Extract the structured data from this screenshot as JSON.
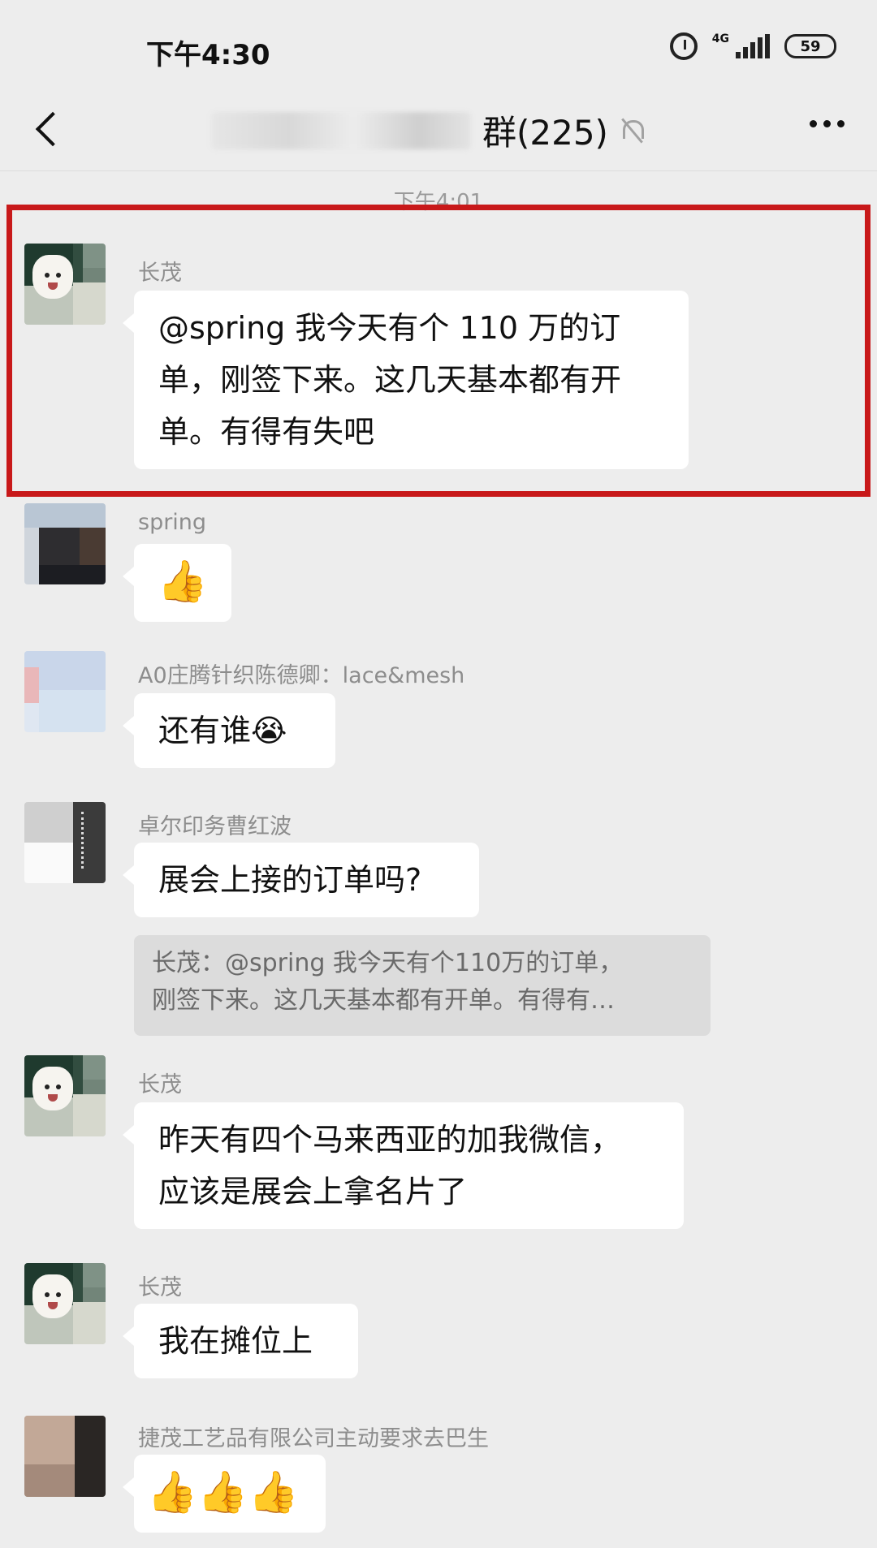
{
  "status_bar": {
    "time": "下午4:30",
    "network": "4G",
    "battery": "59"
  },
  "header": {
    "title": "群(225)"
  },
  "timestamp": "下午4:01",
  "messages": [
    {
      "sender": "长茂",
      "text_lines": [
        "@spring  我今天有个 110 万的订",
        "单，刚签下来。这几天基本都有开",
        "单。有得有失吧"
      ]
    },
    {
      "sender": "spring",
      "text": "👍"
    },
    {
      "sender": "A0庄腾针织陈德卿：lace&mesh",
      "text": "还有谁😭"
    },
    {
      "sender": "卓尔印务曹红波",
      "text": "展会上接的订单吗?",
      "quote_lines": [
        "长茂：@spring 我今天有个110万的订单，",
        "刚签下来。这几天基本都有开单。有得有…"
      ]
    },
    {
      "sender": "长茂",
      "text_lines": [
        "昨天有四个马来西亚的加我微信，",
        "应该是展会上拿名片了"
      ]
    },
    {
      "sender": "长茂",
      "text": "我在摊位上"
    },
    {
      "sender": "捷茂工艺品有限公司主动要求去巴生",
      "text": "👍👍👍"
    }
  ]
}
